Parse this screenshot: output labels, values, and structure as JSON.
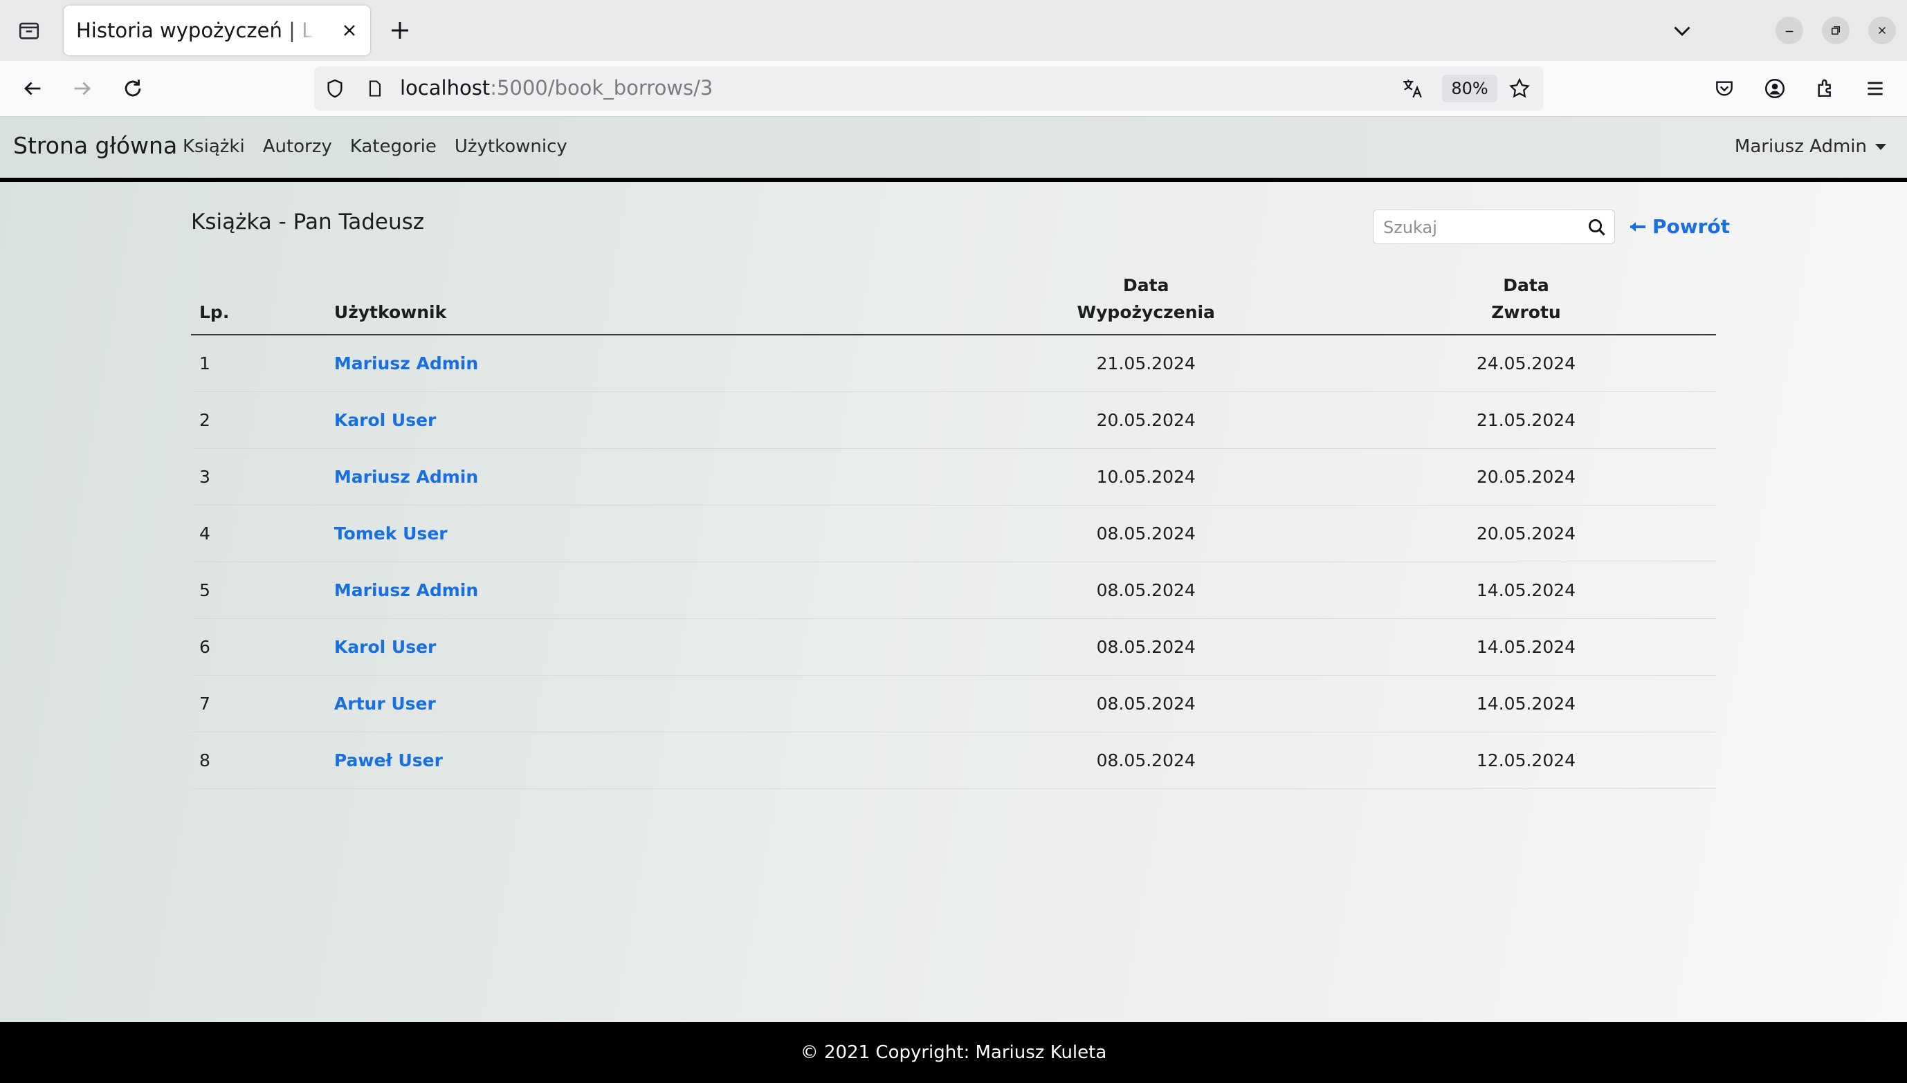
{
  "browser": {
    "tab_title": "Historia wypożyczeń | Library",
    "url_host": "localhost",
    "url_rest": ":5000/book_borrows/3",
    "zoom": "80%"
  },
  "nav": {
    "brand": "Strona główna",
    "links": [
      "Książki",
      "Autorzy",
      "Kategorie",
      "Użytkownicy"
    ],
    "user": "Mariusz Admin"
  },
  "page": {
    "title": "Książka - Pan Tadeusz",
    "search_placeholder": "Szukaj",
    "back_label": "Powrót"
  },
  "table": {
    "headers": {
      "lp": "Lp.",
      "user": "Użytkownik",
      "borrow_date_1": "Data",
      "borrow_date_2": "Wypożyczenia",
      "return_date_1": "Data",
      "return_date_2": "Zwrotu"
    },
    "rows": [
      {
        "lp": "1",
        "user": "Mariusz Admin",
        "borrow": "21.05.2024",
        "return": "24.05.2024"
      },
      {
        "lp": "2",
        "user": "Karol User",
        "borrow": "20.05.2024",
        "return": "21.05.2024"
      },
      {
        "lp": "3",
        "user": "Mariusz Admin",
        "borrow": "10.05.2024",
        "return": "20.05.2024"
      },
      {
        "lp": "4",
        "user": "Tomek User",
        "borrow": "08.05.2024",
        "return": "20.05.2024"
      },
      {
        "lp": "5",
        "user": "Mariusz Admin",
        "borrow": "08.05.2024",
        "return": "14.05.2024"
      },
      {
        "lp": "6",
        "user": "Karol User",
        "borrow": "08.05.2024",
        "return": "14.05.2024"
      },
      {
        "lp": "7",
        "user": "Artur User",
        "borrow": "08.05.2024",
        "return": "14.05.2024"
      },
      {
        "lp": "8",
        "user": "Paweł User",
        "borrow": "08.05.2024",
        "return": "12.05.2024"
      }
    ]
  },
  "footer": "© 2021 Copyright: Mariusz Kuleta"
}
